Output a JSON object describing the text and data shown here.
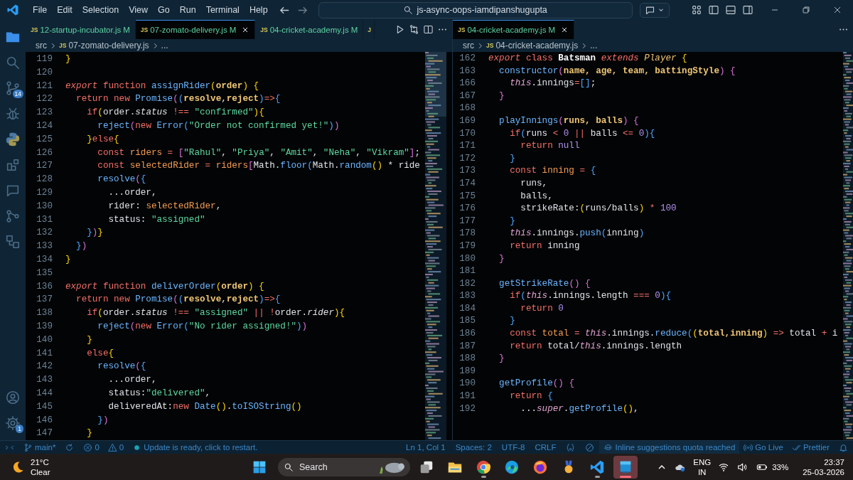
{
  "title_bar": {
    "menu": [
      "File",
      "Edit",
      "Selection",
      "View",
      "Go",
      "Run",
      "Terminal",
      "Help"
    ],
    "command_center": "js-async-oops-iamdipanshugupta"
  },
  "activity_bar": {
    "top": [
      {
        "kind": "files",
        "selected": true
      },
      {
        "kind": "search",
        "selected": false
      },
      {
        "kind": "git",
        "selected": false,
        "badge": "14"
      },
      {
        "kind": "bug",
        "selected": false
      },
      {
        "kind": "python",
        "selected": false
      },
      {
        "kind": "ext",
        "selected": false
      },
      {
        "kind": "chat",
        "selected": false
      },
      {
        "kind": "graph",
        "selected": false
      },
      {
        "kind": "boxes",
        "selected": false
      }
    ],
    "bottom": [
      {
        "kind": "account",
        "selected": false
      },
      {
        "kind": "gear",
        "selected": false,
        "badge": "1"
      }
    ]
  },
  "editor_groups": [
    {
      "tabs": [
        {
          "icon": "JS",
          "label": "12-startup-incubator.js",
          "status": "M",
          "selected": false
        },
        {
          "icon": "JS",
          "label": "07-zomato-delivery.js",
          "status": "M",
          "selected": true
        },
        {
          "icon": "JS",
          "label": "04-cricket-academy.js",
          "status": "M",
          "selected": false
        },
        {
          "icon": "J",
          "selected": false
        }
      ],
      "actions": [
        {
          "kind": "run"
        },
        {
          "kind": "compare"
        },
        {
          "kind": "split"
        },
        {
          "kind": "more"
        }
      ],
      "breadcrumbs": [
        {
          "text": "src"
        },
        {
          "icon": "JS",
          "text": "07-zomato-delivery.js"
        },
        {
          "text": "..."
        }
      ],
      "lines": [
        {
          "n": "119",
          "code": [
            {
              "text": "}",
              "kind": "b1"
            }
          ]
        },
        {
          "n": "120"
        },
        {
          "n": "121",
          "code": [
            {
              "text": "export ",
              "kind": "kwi"
            },
            {
              "text": "function ",
              "kind": "kw"
            },
            {
              "text": "assignRider",
              "kind": "fn"
            },
            {
              "text": "(",
              "kind": "b1"
            },
            {
              "text": "order",
              "kind": "prm"
            },
            {
              "text": ")",
              "kind": "b1"
            },
            {
              "text": " {",
              "kind": "b1"
            }
          ]
        },
        {
          "n": "122",
          "code": [
            {
              "text": "  return new ",
              "kind": "kw"
            },
            {
              "text": "Promise",
              "kind": "fn"
            },
            {
              "text": "(",
              "kind": "b2"
            },
            {
              "text": "(",
              "kind": "b3"
            },
            {
              "text": "resolve",
              "kind": "prm"
            },
            {
              "text": ",",
              "kind": "txt"
            },
            {
              "text": "reject",
              "kind": "prm"
            },
            {
              "text": ")",
              "kind": "b3"
            },
            {
              "text": "=>",
              "kind": "kw"
            },
            {
              "text": "{",
              "kind": "b3"
            }
          ]
        },
        {
          "n": "123",
          "code": [
            {
              "text": "    if",
              "kind": "kw"
            },
            {
              "text": "(",
              "kind": "b1"
            },
            {
              "text": "order.",
              "kind": "txt"
            },
            {
              "text": "status",
              "kind": "prop"
            },
            {
              "text": " !== ",
              "kind": "kw"
            },
            {
              "text": "\"confirmed\"",
              "kind": "str"
            },
            {
              "text": ")",
              "kind": "b1"
            },
            {
              "text": "{",
              "kind": "b1"
            }
          ]
        },
        {
          "n": "124",
          "code": [
            {
              "text": "      reject",
              "kind": "fn"
            },
            {
              "text": "(",
              "kind": "b2"
            },
            {
              "text": "new ",
              "kind": "kw"
            },
            {
              "text": "Error",
              "kind": "fn"
            },
            {
              "text": "(",
              "kind": "b3"
            },
            {
              "text": "\"Order not confirmed yet!\"",
              "kind": "str"
            },
            {
              "text": ")",
              "kind": "b3"
            },
            {
              "text": ")",
              "kind": "b2"
            }
          ]
        },
        {
          "n": "125",
          "code": [
            {
              "text": "    }",
              "kind": "b1"
            },
            {
              "text": "else",
              "kind": "kw"
            },
            {
              "text": "{",
              "kind": "b1"
            }
          ]
        },
        {
          "n": "126",
          "code": [
            {
              "text": "      const ",
              "kind": "kw"
            },
            {
              "text": "riders",
              "kind": "var"
            },
            {
              "text": " = ",
              "kind": "kw"
            },
            {
              "text": "[",
              "kind": "b2"
            },
            {
              "text": "\"Rahul\"",
              "kind": "str"
            },
            {
              "text": ", ",
              "kind": "txt"
            },
            {
              "text": "\"Priya\"",
              "kind": "str"
            },
            {
              "text": ", ",
              "kind": "txt"
            },
            {
              "text": "\"Amit\"",
              "kind": "str"
            },
            {
              "text": ", ",
              "kind": "txt"
            },
            {
              "text": "\"Neha\"",
              "kind": "str"
            },
            {
              "text": ", ",
              "kind": "txt"
            },
            {
              "text": "\"Vikram\"",
              "kind": "str"
            },
            {
              "text": "]",
              "kind": "b2"
            },
            {
              "text": ";",
              "kind": "txt"
            }
          ]
        },
        {
          "n": "127",
          "code": [
            {
              "text": "      const ",
              "kind": "kw"
            },
            {
              "text": "selectedRider",
              "kind": "var"
            },
            {
              "text": " = ",
              "kind": "kw"
            },
            {
              "text": "riders",
              "kind": "var"
            },
            {
              "text": "[",
              "kind": "b2"
            },
            {
              "text": "Math.",
              "kind": "txt"
            },
            {
              "text": "floor",
              "kind": "fn"
            },
            {
              "text": "(",
              "kind": "b3"
            },
            {
              "text": "Math.",
              "kind": "txt"
            },
            {
              "text": "random",
              "kind": "fn"
            },
            {
              "text": "()",
              "kind": "b1"
            },
            {
              "text": " * ride",
              "kind": "txt"
            }
          ]
        },
        {
          "n": "128",
          "code": [
            {
              "text": "      resolve",
              "kind": "fn"
            },
            {
              "text": "(",
              "kind": "b2"
            },
            {
              "text": "{",
              "kind": "b3"
            }
          ]
        },
        {
          "n": "129",
          "code": [
            {
              "text": "        ...order,",
              "kind": "txt"
            }
          ]
        },
        {
          "n": "130",
          "code": [
            {
              "text": "        rider: ",
              "kind": "txt"
            },
            {
              "text": "selectedRider",
              "kind": "var"
            },
            {
              "text": ",",
              "kind": "txt"
            }
          ]
        },
        {
          "n": "131",
          "code": [
            {
              "text": "        status: ",
              "kind": "txt"
            },
            {
              "text": "\"assigned\"",
              "kind": "str"
            }
          ]
        },
        {
          "n": "132",
          "code": [
            {
              "text": "    }",
              "kind": "b3"
            },
            {
              "text": ")",
              "kind": "b2"
            },
            {
              "text": "}",
              "kind": "b1"
            }
          ]
        },
        {
          "n": "133",
          "code": [
            {
              "text": "  }",
              "kind": "b3"
            },
            {
              "text": ")",
              "kind": "b2"
            }
          ]
        },
        {
          "n": "134",
          "code": [
            {
              "text": "}",
              "kind": "b1"
            }
          ]
        },
        {
          "n": "135"
        },
        {
          "n": "136",
          "code": [
            {
              "text": "export ",
              "kind": "kwi"
            },
            {
              "text": "function ",
              "kind": "kw"
            },
            {
              "text": "deliverOrder",
              "kind": "fn"
            },
            {
              "text": "(",
              "kind": "b1"
            },
            {
              "text": "order",
              "kind": "prm"
            },
            {
              "text": ")",
              "kind": "b1"
            },
            {
              "text": " {",
              "kind": "b1"
            }
          ]
        },
        {
          "n": "137",
          "code": [
            {
              "text": "  return new ",
              "kind": "kw"
            },
            {
              "text": "Promise",
              "kind": "fn"
            },
            {
              "text": "(",
              "kind": "b2"
            },
            {
              "text": "(",
              "kind": "b3"
            },
            {
              "text": "resolve",
              "kind": "prm"
            },
            {
              "text": ",",
              "kind": "txt"
            },
            {
              "text": "reject",
              "kind": "prm"
            },
            {
              "text": ")",
              "kind": "b3"
            },
            {
              "text": "=>",
              "kind": "kw"
            },
            {
              "text": "{",
              "kind": "b3"
            }
          ]
        },
        {
          "n": "138",
          "code": [
            {
              "text": "    if",
              "kind": "kw"
            },
            {
              "text": "(",
              "kind": "b1"
            },
            {
              "text": "order.",
              "kind": "txt"
            },
            {
              "text": "status",
              "kind": "prop"
            },
            {
              "text": " !== ",
              "kind": "kw"
            },
            {
              "text": "\"assigned\"",
              "kind": "str"
            },
            {
              "text": " || !",
              "kind": "kw"
            },
            {
              "text": "order.",
              "kind": "txt"
            },
            {
              "text": "rider",
              "kind": "prop"
            },
            {
              "text": ")",
              "kind": "b1"
            },
            {
              "text": "{",
              "kind": "b1"
            }
          ]
        },
        {
          "n": "139",
          "code": [
            {
              "text": "      reject",
              "kind": "fn"
            },
            {
              "text": "(",
              "kind": "b2"
            },
            {
              "text": "new ",
              "kind": "kw"
            },
            {
              "text": "Error",
              "kind": "fn"
            },
            {
              "text": "(",
              "kind": "b3"
            },
            {
              "text": "\"No rider assigned!\"",
              "kind": "str"
            },
            {
              "text": ")",
              "kind": "b3"
            },
            {
              "text": ")",
              "kind": "b2"
            }
          ]
        },
        {
          "n": "140",
          "code": [
            {
              "text": "    }",
              "kind": "b1"
            }
          ]
        },
        {
          "n": "141",
          "code": [
            {
              "text": "    else",
              "kind": "kw"
            },
            {
              "text": "{",
              "kind": "b1"
            }
          ]
        },
        {
          "n": "142",
          "code": [
            {
              "text": "      resolve",
              "kind": "fn"
            },
            {
              "text": "(",
              "kind": "b2"
            },
            {
              "text": "{",
              "kind": "b3"
            }
          ]
        },
        {
          "n": "143",
          "code": [
            {
              "text": "        ...order,",
              "kind": "txt"
            }
          ]
        },
        {
          "n": "144",
          "code": [
            {
              "text": "        status:",
              "kind": "txt"
            },
            {
              "text": "\"delivered\"",
              "kind": "str"
            },
            {
              "text": ",",
              "kind": "txt"
            }
          ]
        },
        {
          "n": "145",
          "code": [
            {
              "text": "        deliveredAt:",
              "kind": "txt"
            },
            {
              "text": "new ",
              "kind": "kw"
            },
            {
              "text": "Date",
              "kind": "fn"
            },
            {
              "text": "()",
              "kind": "b1"
            },
            {
              "text": ".",
              "kind": "txt"
            },
            {
              "text": "toISOString",
              "kind": "fn"
            },
            {
              "text": "()",
              "kind": "b1"
            }
          ]
        },
        {
          "n": "146",
          "code": [
            {
              "text": "      }",
              "kind": "b3"
            },
            {
              "text": ")",
              "kind": "b2"
            }
          ]
        },
        {
          "n": "147",
          "code": [
            {
              "text": "    }",
              "kind": "b1"
            }
          ]
        }
      ]
    },
    {
      "tabs": [
        {
          "icon": "JS",
          "label": "04-cricket-academy.js",
          "status": "M",
          "selected": true
        }
      ],
      "actions": [
        {
          "kind": "more"
        }
      ],
      "breadcrumbs": [
        {
          "text": "src"
        },
        {
          "icon": "JS",
          "text": "04-cricket-academy.js"
        },
        {
          "text": "..."
        }
      ],
      "lines": [
        {
          "n": "162",
          "code": [
            {
              "text": "export ",
              "kind": "kwi"
            },
            {
              "text": "class ",
              "kind": "kw"
            },
            {
              "text": "Batsman",
              "kind": "cls"
            },
            {
              "text": " extends ",
              "kind": "kwi"
            },
            {
              "text": "Player",
              "kind": "clsi"
            },
            {
              "text": " {",
              "kind": "b1"
            }
          ]
        },
        {
          "n": "163",
          "code": [
            {
              "text": "  constructor",
              "kind": "fn"
            },
            {
              "text": "(",
              "kind": "b2"
            },
            {
              "text": "name, age, team, battingStyle",
              "kind": "prm"
            },
            {
              "text": ")",
              "kind": "b2"
            },
            {
              "text": " {",
              "kind": "b2"
            }
          ]
        },
        {
          "n": "166",
          "code": [
            {
              "text": "    this",
              "kind": "this"
            },
            {
              "text": ".innings",
              "kind": "txt"
            },
            {
              "text": "=",
              "kind": "kw"
            },
            {
              "text": "[]",
              "kind": "b3"
            },
            {
              "text": ";",
              "kind": "txt"
            }
          ]
        },
        {
          "n": "167",
          "code": [
            {
              "text": "  }",
              "kind": "b2"
            }
          ]
        },
        {
          "n": "168"
        },
        {
          "n": "169",
          "code": [
            {
              "text": "  playInnings",
              "kind": "fn"
            },
            {
              "text": "(",
              "kind": "b2"
            },
            {
              "text": "runs, balls",
              "kind": "prm"
            },
            {
              "text": ")",
              "kind": "b2"
            },
            {
              "text": " {",
              "kind": "b2"
            }
          ]
        },
        {
          "n": "170",
          "code": [
            {
              "text": "    if",
              "kind": "kw"
            },
            {
              "text": "(",
              "kind": "b3"
            },
            {
              "text": "runs ",
              "kind": "txt"
            },
            {
              "text": "<",
              "kind": "kw"
            },
            {
              "text": " 0",
              "kind": "num"
            },
            {
              "text": " ||",
              "kind": "kw"
            },
            {
              "text": " balls ",
              "kind": "txt"
            },
            {
              "text": "<=",
              "kind": "kw"
            },
            {
              "text": " 0",
              "kind": "num"
            },
            {
              "text": ")",
              "kind": "b3"
            },
            {
              "text": "{",
              "kind": "b3"
            }
          ]
        },
        {
          "n": "171",
          "code": [
            {
              "text": "      return ",
              "kind": "kw"
            },
            {
              "text": "null",
              "kind": "num"
            }
          ]
        },
        {
          "n": "172",
          "code": [
            {
              "text": "    }",
              "kind": "b3"
            }
          ]
        },
        {
          "n": "173",
          "code": [
            {
              "text": "    const ",
              "kind": "kw"
            },
            {
              "text": "inning",
              "kind": "var"
            },
            {
              "text": " = ",
              "kind": "kw"
            },
            {
              "text": "{",
              "kind": "b3"
            }
          ]
        },
        {
          "n": "174",
          "code": [
            {
              "text": "      runs,",
              "kind": "txt"
            }
          ]
        },
        {
          "n": "175",
          "code": [
            {
              "text": "      balls,",
              "kind": "txt"
            }
          ]
        },
        {
          "n": "176",
          "code": [
            {
              "text": "      strikeRate:",
              "kind": "txt"
            },
            {
              "text": "(",
              "kind": "b1"
            },
            {
              "text": "runs/balls",
              "kind": "txt"
            },
            {
              "text": ")",
              "kind": "b1"
            },
            {
              "text": " * ",
              "kind": "kw"
            },
            {
              "text": "100",
              "kind": "num"
            }
          ]
        },
        {
          "n": "177",
          "code": [
            {
              "text": "    }",
              "kind": "b3"
            }
          ]
        },
        {
          "n": "178",
          "code": [
            {
              "text": "    this",
              "kind": "this"
            },
            {
              "text": ".innings.",
              "kind": "txt"
            },
            {
              "text": "push",
              "kind": "fn"
            },
            {
              "text": "(",
              "kind": "b3"
            },
            {
              "text": "inning",
              "kind": "txt"
            },
            {
              "text": ")",
              "kind": "b3"
            }
          ]
        },
        {
          "n": "179",
          "code": [
            {
              "text": "    return",
              "kind": "kw"
            },
            {
              "text": " inning",
              "kind": "txt"
            }
          ]
        },
        {
          "n": "180",
          "code": [
            {
              "text": "  }",
              "kind": "b2"
            }
          ]
        },
        {
          "n": "181"
        },
        {
          "n": "182",
          "code": [
            {
              "text": "  getStrikeRate",
              "kind": "fn"
            },
            {
              "text": "()",
              "kind": "b2"
            },
            {
              "text": " {",
              "kind": "b2"
            }
          ]
        },
        {
          "n": "183",
          "code": [
            {
              "text": "    if",
              "kind": "kw"
            },
            {
              "text": "(",
              "kind": "b3"
            },
            {
              "text": "this",
              "kind": "this"
            },
            {
              "text": ".innings.length ",
              "kind": "txt"
            },
            {
              "text": "===",
              "kind": "kw"
            },
            {
              "text": " 0",
              "kind": "num"
            },
            {
              "text": ")",
              "kind": "b3"
            },
            {
              "text": "{",
              "kind": "b3"
            }
          ]
        },
        {
          "n": "184",
          "code": [
            {
              "text": "      return ",
              "kind": "kw"
            },
            {
              "text": "0",
              "kind": "num"
            }
          ]
        },
        {
          "n": "185",
          "code": [
            {
              "text": "    }",
              "kind": "b3"
            }
          ]
        },
        {
          "n": "186",
          "code": [
            {
              "text": "    const ",
              "kind": "kw"
            },
            {
              "text": "total",
              "kind": "var"
            },
            {
              "text": " = ",
              "kind": "kw"
            },
            {
              "text": "this",
              "kind": "this"
            },
            {
              "text": ".innings.",
              "kind": "txt"
            },
            {
              "text": "reduce",
              "kind": "fn"
            },
            {
              "text": "(",
              "kind": "b3"
            },
            {
              "text": "(",
              "kind": "b1"
            },
            {
              "text": "total,inning",
              "kind": "prm"
            },
            {
              "text": ")",
              "kind": "b1"
            },
            {
              "text": " =>",
              "kind": "kw"
            },
            {
              "text": " total ",
              "kind": "txt"
            },
            {
              "text": "+",
              "kind": "kw"
            },
            {
              "text": " i",
              "kind": "txt"
            }
          ]
        },
        {
          "n": "187",
          "code": [
            {
              "text": "    return",
              "kind": "kw"
            },
            {
              "text": " total/",
              "kind": "txt"
            },
            {
              "text": "this",
              "kind": "this"
            },
            {
              "text": ".innings.length",
              "kind": "txt"
            }
          ]
        },
        {
          "n": "188",
          "code": [
            {
              "text": "  }",
              "kind": "b2"
            }
          ]
        },
        {
          "n": "189"
        },
        {
          "n": "190",
          "code": [
            {
              "text": "  getProfile",
              "kind": "fn"
            },
            {
              "text": "()",
              "kind": "b2"
            },
            {
              "text": " {",
              "kind": "b2"
            }
          ]
        },
        {
          "n": "191",
          "code": [
            {
              "text": "    return ",
              "kind": "kw"
            },
            {
              "text": "{",
              "kind": "b3"
            }
          ]
        },
        {
          "n": "192",
          "code": [
            {
              "text": "      ...",
              "kind": "txt"
            },
            {
              "text": "super",
              "kind": "this"
            },
            {
              "text": ".",
              "kind": "txt"
            },
            {
              "text": "getProfile",
              "kind": "fn"
            },
            {
              "text": "()",
              "kind": "b1"
            },
            {
              "text": ",",
              "kind": "txt"
            }
          ]
        }
      ]
    }
  ],
  "status_bar": {
    "left": [
      {
        "kind": "remote"
      },
      {
        "kind": "branch",
        "text": "main*"
      },
      {
        "kind": "sync"
      },
      {
        "kind": "errors",
        "text": "0"
      },
      {
        "kind": "warnings",
        "text": "0"
      },
      {
        "kind": "update",
        "text": "Update is ready, click to restart."
      }
    ],
    "right": [
      {
        "kind": "text",
        "text": "Ln 1, Col 1"
      },
      {
        "kind": "text",
        "text": "Spaces: 2"
      },
      {
        "kind": "text",
        "text": "UTF-8"
      },
      {
        "kind": "text",
        "text": "CRLF"
      },
      {
        "kind": "braces"
      },
      {
        "kind": "blocked"
      },
      {
        "kind": "copilot",
        "text": "Inline suggestions quota reached"
      },
      {
        "kind": "live",
        "text": "Go Live"
      },
      {
        "kind": "check",
        "text": "Prettier"
      },
      {
        "kind": "bell"
      }
    ]
  },
  "taskbar": {
    "weather": {
      "temp": "21°C",
      "condition": "Clear"
    },
    "search_label": "Search",
    "apps": [
      {
        "kind": "taskview",
        "running": false,
        "selected": false
      },
      {
        "kind": "folder",
        "running": false,
        "selected": false
      },
      {
        "kind": "chrome",
        "running": true,
        "selected": false
      },
      {
        "kind": "edge",
        "running": false,
        "selected": false
      },
      {
        "kind": "firefox",
        "running": false,
        "selected": false
      },
      {
        "kind": "medal",
        "running": false,
        "selected": false
      },
      {
        "kind": "vscode",
        "running": true,
        "selected": false
      },
      {
        "kind": "window",
        "running": true,
        "selected": true
      }
    ],
    "tray": {
      "language": "ENG",
      "region": "IN",
      "battery": "33%",
      "time": "23:37",
      "date": "25-03-2026"
    }
  }
}
